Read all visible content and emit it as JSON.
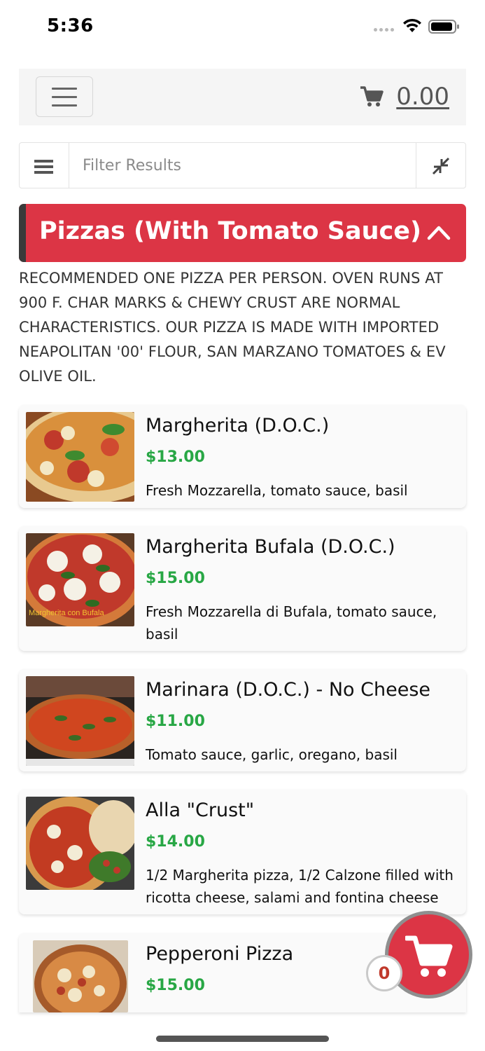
{
  "status_bar": {
    "time": "5:36"
  },
  "navbar": {
    "cart_total": "0.00",
    "icons": {
      "menu": "hamburger-icon",
      "cart": "cart-icon"
    }
  },
  "filter": {
    "placeholder": "Filter Results",
    "icons": {
      "menu": "list-icon",
      "collapse": "compress-icon"
    }
  },
  "category": {
    "title": "Pizzas (With Tomato Sauce)",
    "description": "RECOMMENDED ONE PIZZA PER PERSON. OVEN RUNS AT 900 F. CHAR MARKS & CHEWY CRUST ARE NORMAL CHARACTERISTICS. OUR PIZZA IS MADE WITH IMPORTED NEAPOLITAN '00' FLOUR, SAN MARZANO TOMATOES & EV OLIVE OIL.",
    "accent_color": "#dc3545"
  },
  "items": [
    {
      "name": "Margherita (D.O.C.)",
      "price": "$13.00",
      "description": "Fresh Mozzarella, tomato sauce, basil"
    },
    {
      "name": "Margherita Bufala (D.O.C.)",
      "price": "$15.00",
      "description": "Fresh Mozzarella di Bufala, tomato sauce, basil",
      "image_caption": "Margherita con Bufala"
    },
    {
      "name": "Marinara (D.O.C.) - No Cheese",
      "price": "$11.00",
      "description": "Tomato sauce, garlic, oregano, basil"
    },
    {
      "name": "Alla \"Crust\"",
      "price": "$14.00",
      "description": "1/2 Margherita pizza, 1/2 Calzone filled with ricotta cheese, salami and fontina cheese"
    },
    {
      "name": "Pepperoni Pizza",
      "price": "$15.00",
      "description": ""
    }
  ],
  "floating_cart": {
    "count": "0"
  },
  "colors": {
    "price": "#28a745",
    "brand_red": "#dc3545"
  }
}
